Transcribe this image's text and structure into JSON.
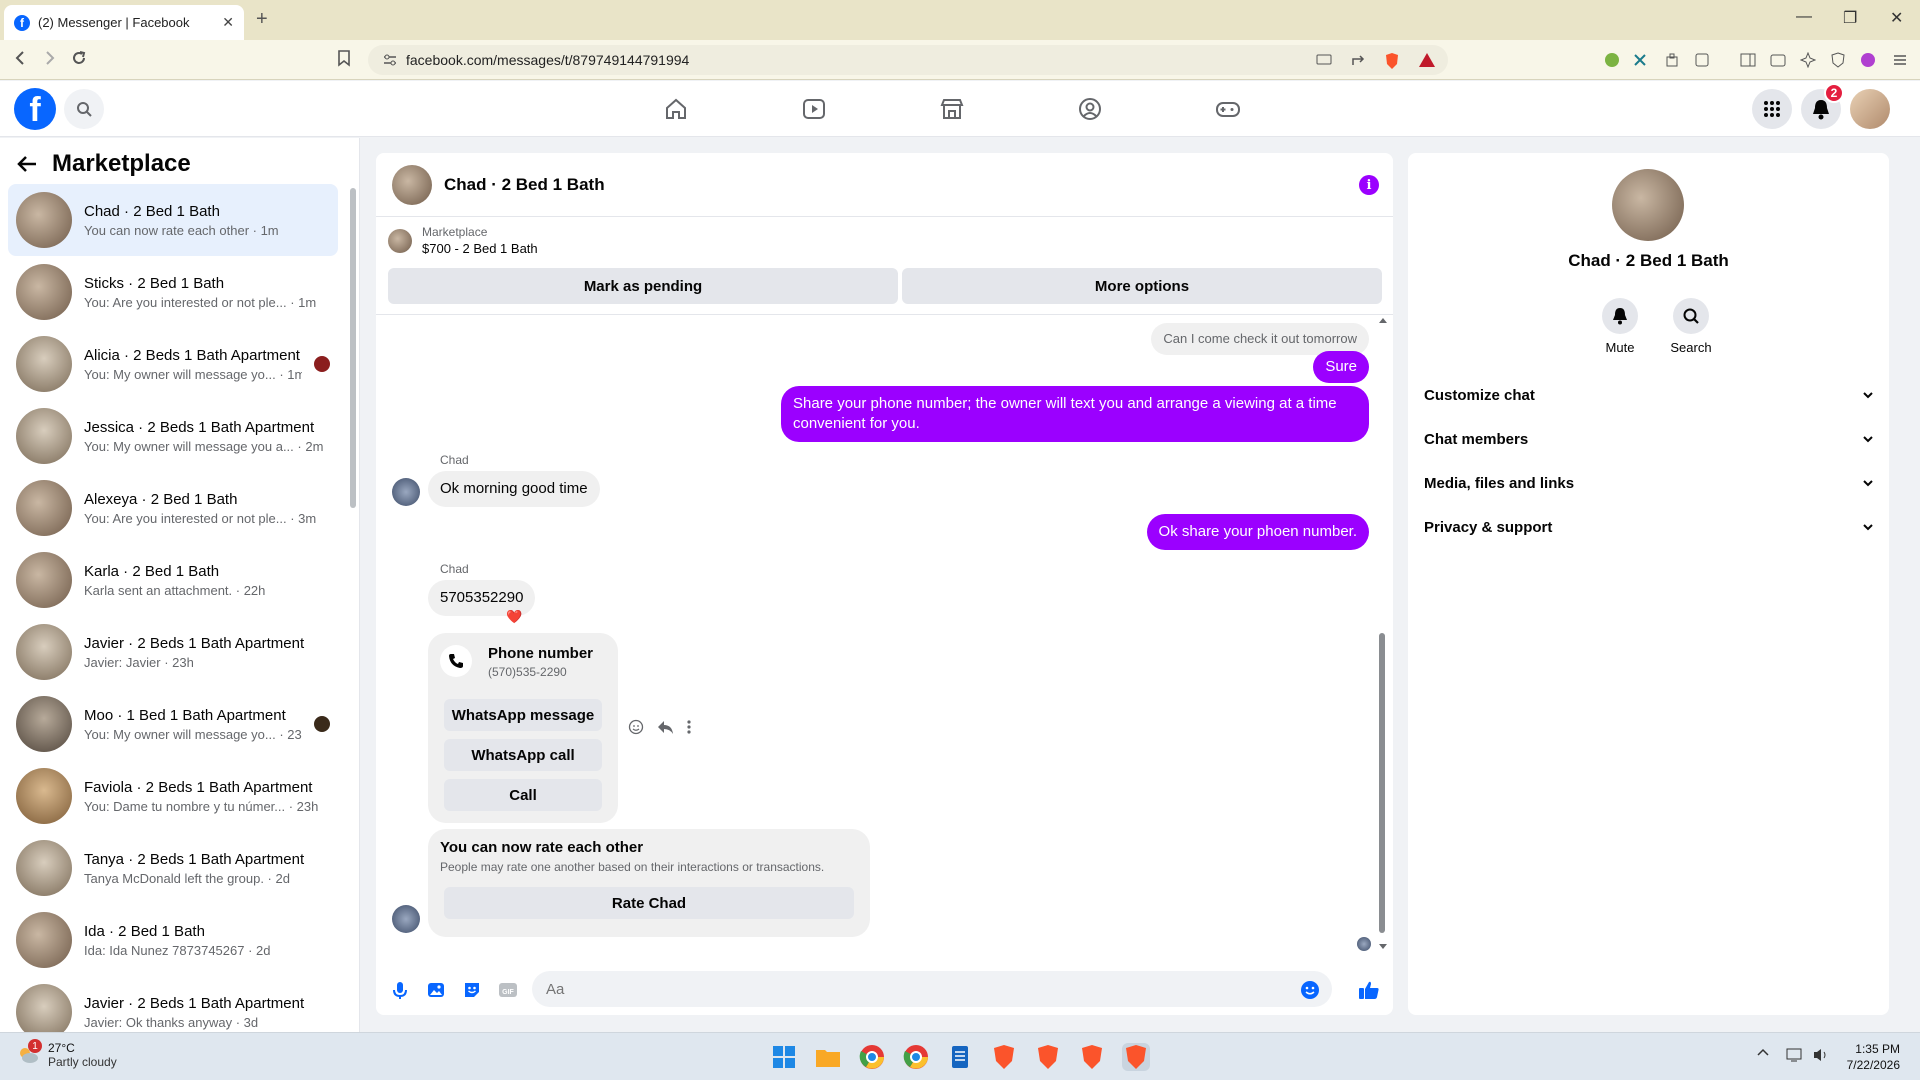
{
  "browser": {
    "tab_title": "(2) Messenger | Facebook",
    "url": "facebook.com/messages/t/879749144791994"
  },
  "header": {
    "notification_count": "2",
    "accent": "#0866ff"
  },
  "sidebar": {
    "title": "Marketplace",
    "conversations": [
      {
        "name": "Chad · 2 Bed 1 Bath",
        "preview": "You can now rate each other · 1m",
        "active": true
      },
      {
        "name": "Sticks · 2 Bed 1 Bath",
        "preview": "You: Are you interested or not ple... · 1m"
      },
      {
        "name": "Alicia · 2 Beds 1 Bath Apartment",
        "preview": "You: My owner will message yo... · 1m"
      },
      {
        "name": "Jessica · 2 Beds 1 Bath Apartment",
        "preview": "You: My owner will message you a... · 2m"
      },
      {
        "name": "Alexeya · 2 Bed 1 Bath",
        "preview": "You: Are you interested or not ple... · 3m"
      },
      {
        "name": "Karla · 2 Bed 1 Bath",
        "preview": "Karla sent an attachment. · 22h"
      },
      {
        "name": "Javier · 2 Beds 1 Bath Apartment",
        "preview": "Javier: Javier · 23h"
      },
      {
        "name": "Moo · 1 Bed 1 Bath Apartment",
        "preview": "You: My owner will message yo... · 23h"
      },
      {
        "name": "Faviola · 2 Beds 1 Bath Apartment",
        "preview": "You: Dame tu nombre y tu númer... · 23h"
      },
      {
        "name": "Tanya · 2 Beds 1 Bath Apartment",
        "preview": "Tanya McDonald left the group. · 2d"
      },
      {
        "name": "Ida · 2 Bed 1 Bath",
        "preview": "Ida: Ida Nunez 7873745267 · 2d"
      },
      {
        "name": "Javier · 2 Beds 1 Bath Apartment",
        "preview": "Javier: Ok thanks anyway · 3d"
      }
    ]
  },
  "chat": {
    "title": "Chad · 2 Bed 1 Bath",
    "listing_label": "Marketplace",
    "listing_price": "$700 - 2 Bed 1 Bath",
    "mark_pending": "Mark as pending",
    "more_options": "More options",
    "quoted_reply": "Can I come check it out tomorrow",
    "msg_sure": "Sure",
    "msg_share": "Share your phone number; the owner will text you and arrange a viewing at a time convenient for you.",
    "sender_1": "Chad",
    "msg_ok_morning": "Ok morning good time",
    "msg_ok_share": "Ok share your phoen number.",
    "sender_2": "Chad",
    "msg_number": "5705352290",
    "reaction": "❤️",
    "phone_card": {
      "title": "Phone number",
      "number": "(570)535-2290",
      "whatsapp_message": "WhatsApp message",
      "whatsapp_call": "WhatsApp call",
      "call": "Call"
    },
    "rate_card": {
      "title": "You can now rate each other",
      "desc": "People may rate one another based on their interactions or transactions.",
      "button": "Rate Chad"
    },
    "composer_placeholder": "Aa",
    "bubble_color": "#9b00ff"
  },
  "info_panel": {
    "name": "Chad · 2 Bed 1 Bath",
    "mute": "Mute",
    "search": "Search",
    "rows": [
      "Customize chat",
      "Chat members",
      "Media, files and links",
      "Privacy & support"
    ]
  },
  "taskbar": {
    "temp": "27°C",
    "condition": "Partly cloudy",
    "weather_badge": "1",
    "time": "1:35 PM",
    "date": "7/22/2026"
  }
}
